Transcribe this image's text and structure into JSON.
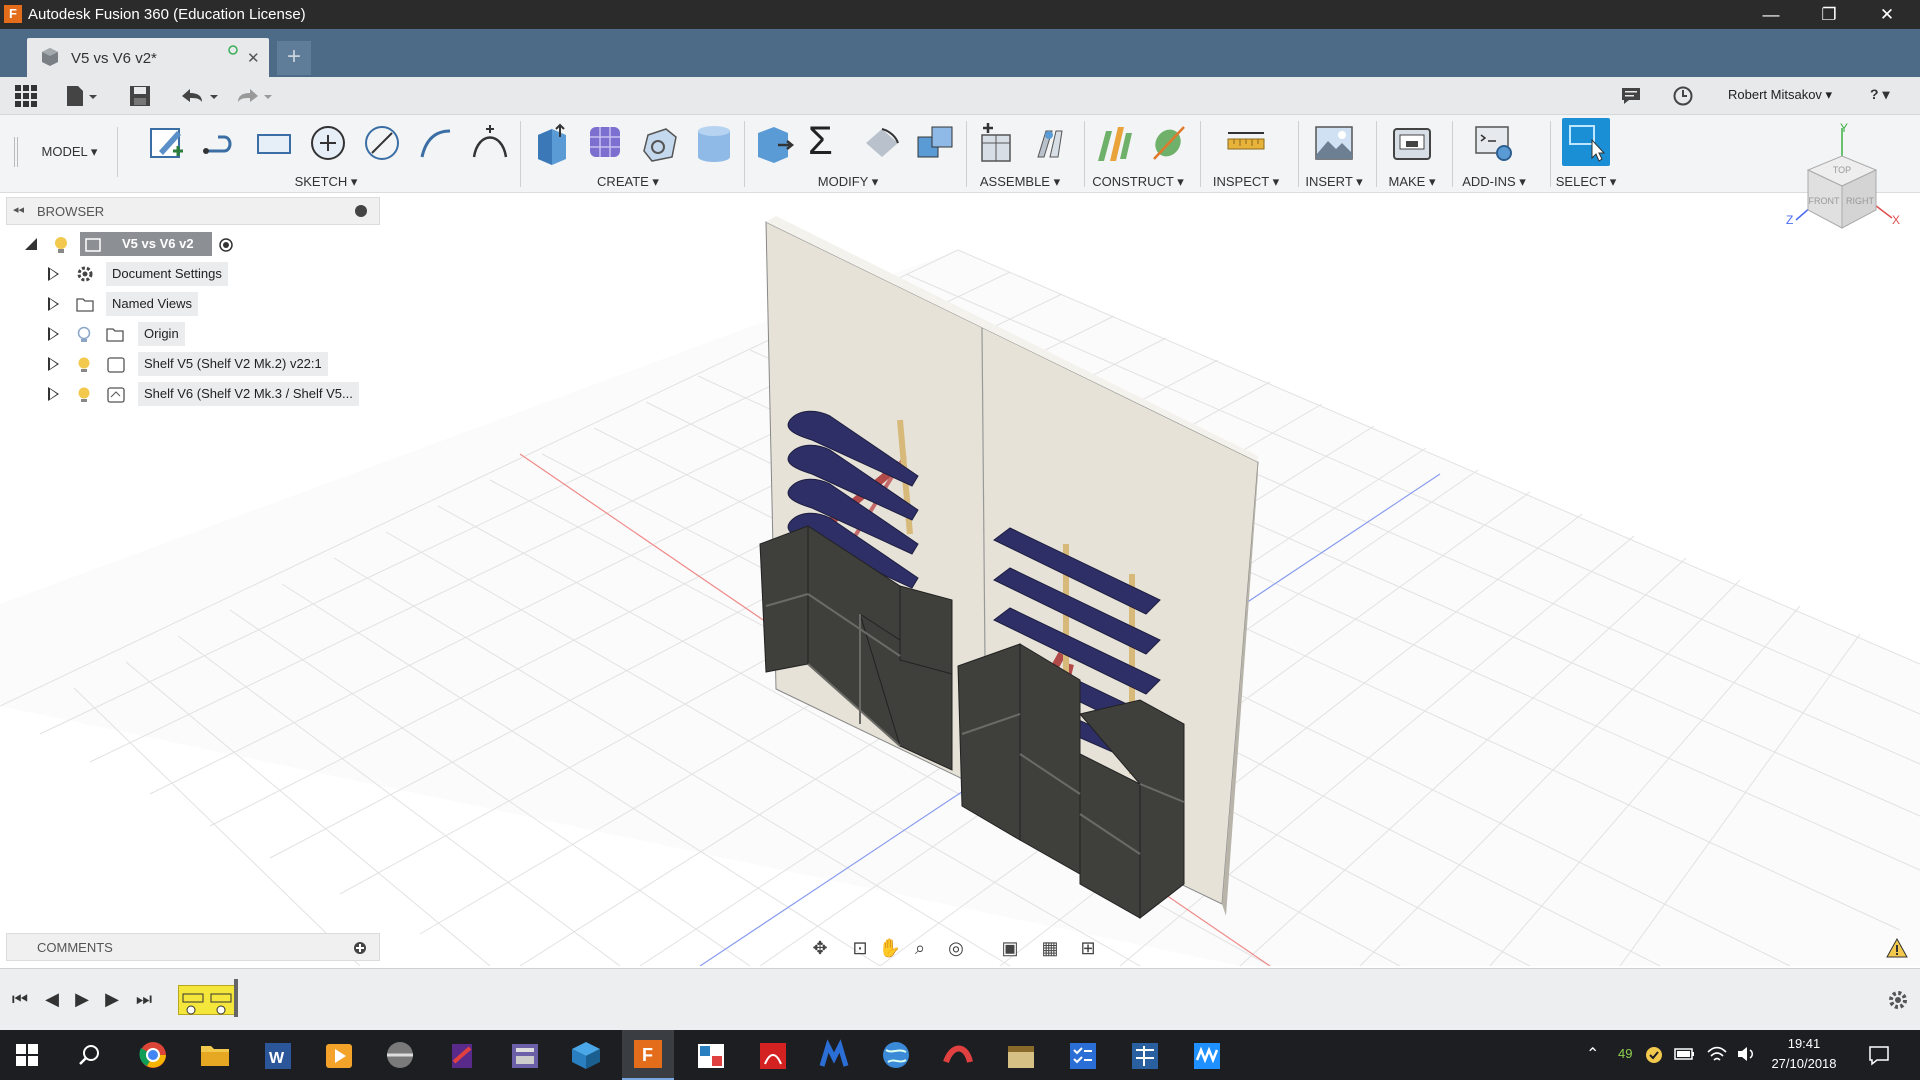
{
  "window": {
    "title": "Autodesk Fusion 360 (Education License)",
    "app_icon": "F",
    "minimize": "—",
    "restore": "❐",
    "close": "✕"
  },
  "tabs": {
    "active_doc": "V5 vs V6 v2*",
    "close": "✕",
    "new_tab": "+"
  },
  "quick_access": {
    "user": "Robert Mitsakov ▾",
    "help": "? ▾"
  },
  "ribbon": {
    "workspace": "MODEL ▾",
    "groups": {
      "sketch": "SKETCH ▾",
      "create": "CREATE ▾",
      "modify": "MODIFY ▾",
      "assemble": "ASSEMBLE ▾",
      "construct": "CONSTRUCT ▾",
      "inspect": "INSPECT ▾",
      "insert": "INSERT ▾",
      "make": "MAKE ▾",
      "addins": "ADD-INS ▾",
      "select": "SELECT ▾"
    }
  },
  "browser": {
    "header": "BROWSER",
    "root": "V5 vs V6 v2",
    "items": [
      {
        "label": "Document Settings",
        "icon": "gear-icon"
      },
      {
        "label": "Named Views",
        "icon": "folder-icon"
      },
      {
        "label": "Origin",
        "icon": "folder-icon"
      },
      {
        "label": "Shelf V5 (Shelf V2 Mk.2) v22:1",
        "icon": "component-icon"
      },
      {
        "label": "Shelf V6 (Shelf V2 Mk.3 / Shelf V5...",
        "icon": "component-icon"
      }
    ]
  },
  "viewcube": {
    "top": "TOP",
    "front": "FRONT",
    "right": "RIGHT",
    "axis_x": "X",
    "axis_y": "Y",
    "axis_z": "Z"
  },
  "comments": {
    "header": "COMMENTS"
  },
  "taskbar": {
    "battery_count": "49",
    "time": "19:41",
    "date": "27/10/2018"
  },
  "colors": {
    "titlebar": "#2b2b2b",
    "tabstrip": "#4d6a87",
    "select_accent": "#1a8fd6",
    "wall": "#e6e2d8",
    "shelf_blue": "#2e2f66",
    "cube_dark": "#3f3f3c",
    "brace_red": "#b24a4a"
  }
}
